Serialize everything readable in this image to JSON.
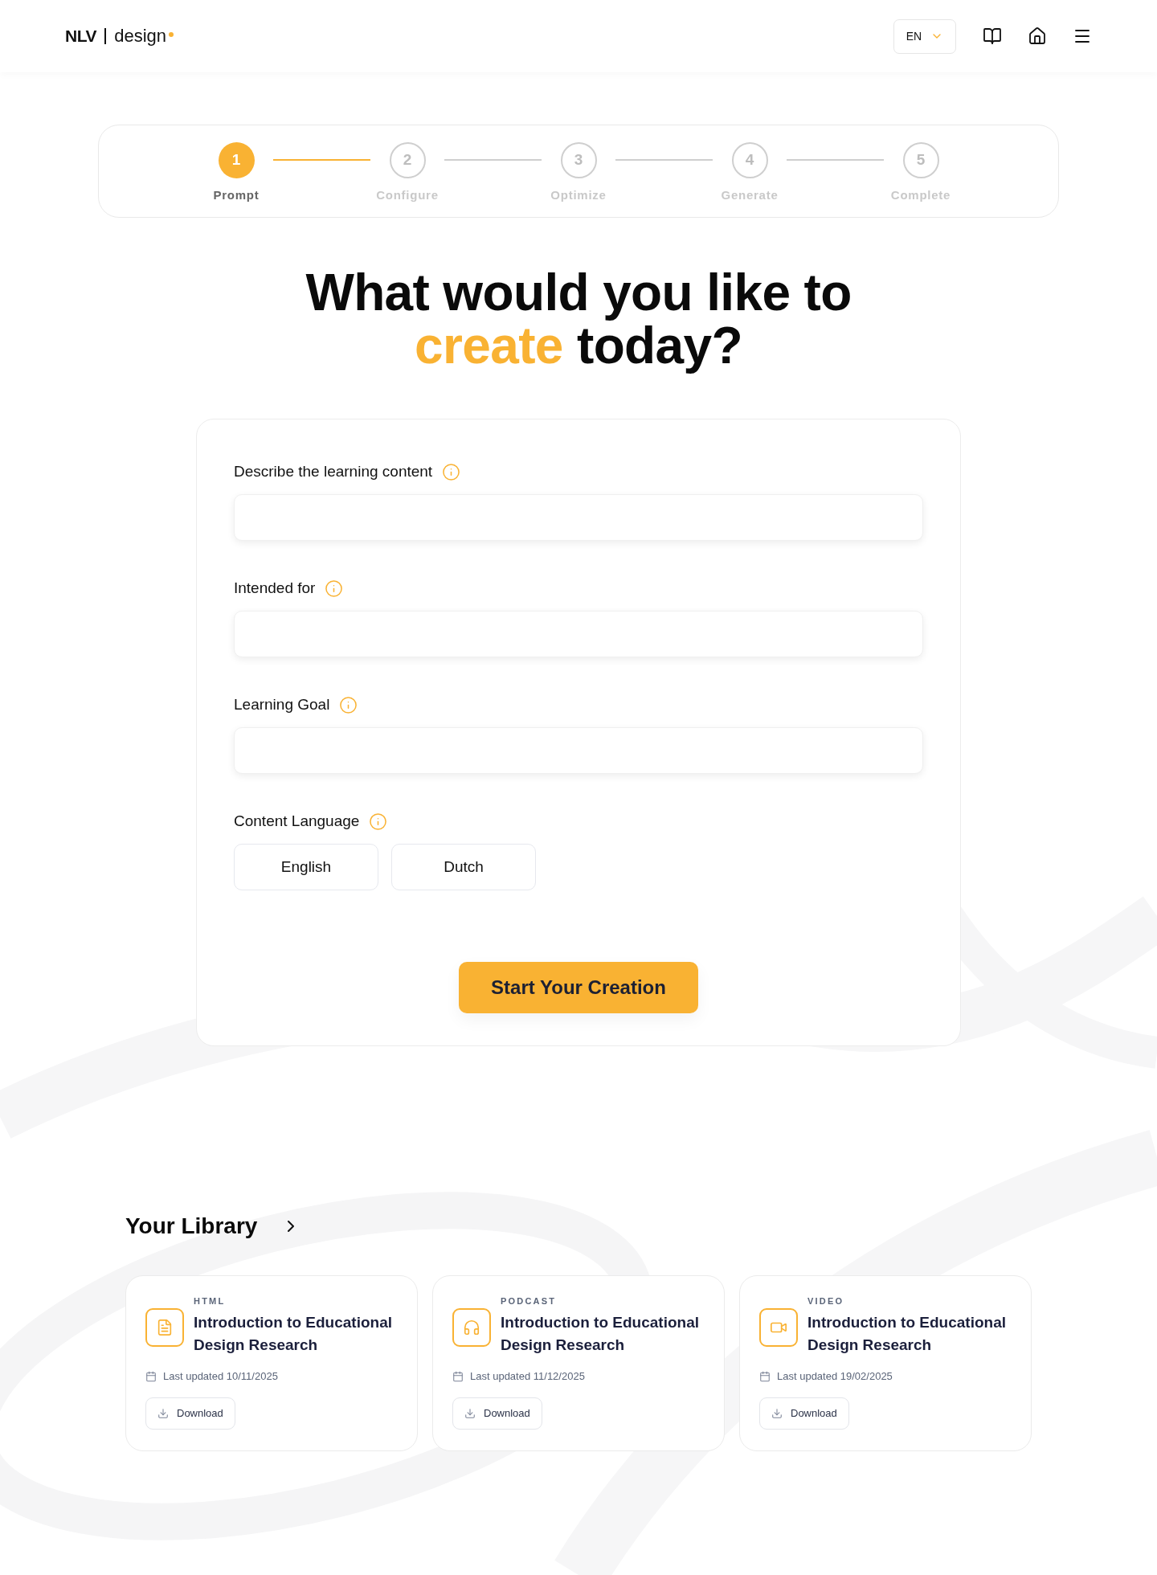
{
  "header": {
    "logo": {
      "mark": "NLV",
      "word": "design"
    },
    "language": {
      "value": "EN"
    }
  },
  "stepper": {
    "steps": [
      {
        "number": "1",
        "label": "Prompt",
        "selected": true
      },
      {
        "number": "2",
        "label": "Configure",
        "selected": false
      },
      {
        "number": "3",
        "label": "Optimize",
        "selected": false
      },
      {
        "number": "4",
        "label": "Generate",
        "selected": false
      },
      {
        "number": "5",
        "label": "Complete",
        "selected": false
      }
    ]
  },
  "heading": {
    "parts": [
      {
        "text": "What would you like to",
        "highlight": false
      },
      {
        "text": "create",
        "highlight": true
      },
      {
        "text": "today?",
        "highlight": false
      }
    ]
  },
  "form": {
    "fields": [
      {
        "label": "Describe the learning content"
      },
      {
        "label": "Intended for"
      },
      {
        "label": "Learning Goal"
      }
    ],
    "language_choice": {
      "label": "Content Language",
      "options": [
        {
          "label": "English",
          "selected": false
        },
        {
          "label": "Dutch",
          "selected": false
        }
      ]
    },
    "submit": "Start Your Creation"
  },
  "library": {
    "title": "Your Library",
    "items": [
      {
        "kind": "html",
        "type": "HTML",
        "title": "Introduction to Educational Design Research",
        "updated": "Last updated 10/11/2025",
        "action": "Download"
      },
      {
        "kind": "podcast",
        "type": "PODCAST",
        "title": "Introduction to Educational Design Research",
        "updated": "Last updated 11/12/2025",
        "action": "Download"
      },
      {
        "kind": "video",
        "type": "VIDEO",
        "title": "Introduction to Educational Design Research",
        "updated": "Last updated 19/02/2025",
        "action": "Download"
      }
    ]
  }
}
